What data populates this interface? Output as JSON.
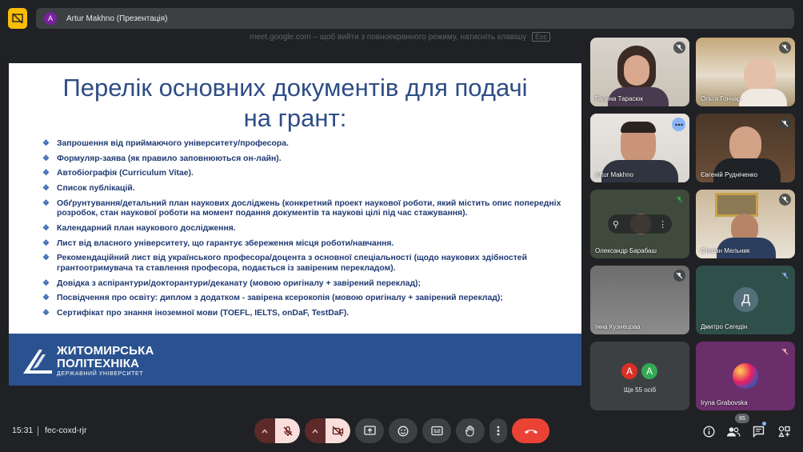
{
  "header": {
    "avatar_initial": "A",
    "title": "Artur Makhno (Презентація)",
    "hint_text": "meet.google.com – щоб вийти з повноекранного режиму, натисніть клавішу",
    "hint_key": "Esc"
  },
  "slide": {
    "title_line1": "Перелік основних документів для подачі",
    "title_line2": "на грант:",
    "bullets": [
      "Запрошення від приймаючого університету/професора.",
      "Формуляр-заява (як правило заповнюються он-лайн).",
      "Автобіографія (Curriculum Vitae).",
      "Список публікацій.",
      "Обґрунтування/детальний план наукових досліджень (конкретний проект наукової роботи, який містить опис попередніх розробок, стан наукової роботи на момент подання документів та наукові цілі під час стажування).",
      "Календарний план наукового дослідження.",
      "Лист від власного університету, що гарантує збереження місця роботи/навчання.",
      "Рекомендаційний лист від українського професора/доцента з основної спеціальності (щодо наукових здібностей грантоотримувача та ставлення професора, подається із завіреним перекладом).",
      "Довідка з аспірантури/докторантури/деканату (мовою оригіналу + завірений переклад);",
      "Посвідчення про освіту: диплом з додатком - завірена ксерокопія (мовою оригіналу + завірений переклад);",
      "Сертифікат про знання іноземної мови (TOEFL, IELTS, onDaF, TestDaF)."
    ],
    "logo_line1": "ЖИТОМИРСЬКА",
    "logo_line2": "ПОЛІТЕХНІКА",
    "logo_line3": "ДЕРЖАВНИЙ УНІВЕРСИТЕТ"
  },
  "participants": [
    {
      "name": "Галина Тарасюк"
    },
    {
      "name": "Ольга Гончар"
    },
    {
      "name": "Artur Makhno"
    },
    {
      "name": "Євгеній Рудніченко"
    },
    {
      "name": "Олександр Барабаш"
    },
    {
      "name": "Степан Мельник"
    },
    {
      "name": "Інна Кузнецова"
    },
    {
      "name": "Дмитро Сегедін",
      "initial": "Д"
    },
    {
      "name": "Iryna Grabovska"
    }
  ],
  "others": {
    "initials": [
      "А",
      "А"
    ],
    "label": "Ще 55 осіб"
  },
  "footer": {
    "time": "15:31",
    "meeting_code": "fec-coxd-rjr",
    "people_count": "65"
  },
  "colors": {
    "slide_title": "#2e4d85",
    "slide_text": "#1f3a73",
    "slide_footer": "#2b5290",
    "hangup": "#ea4335",
    "present_badge": "#fbbc04"
  }
}
